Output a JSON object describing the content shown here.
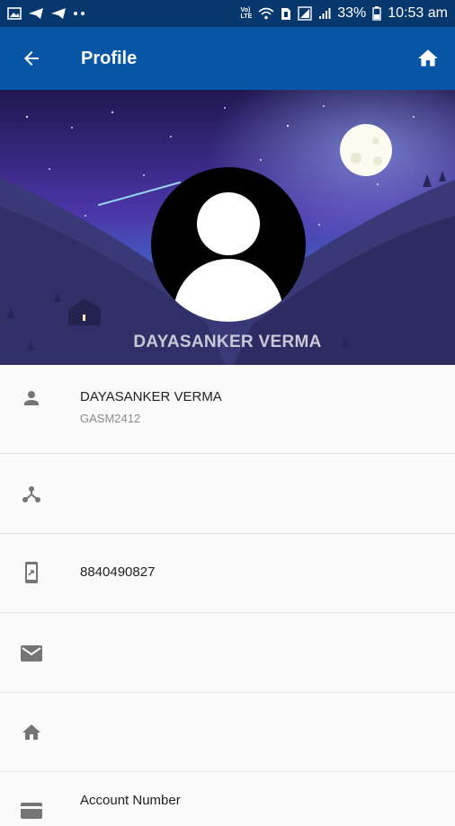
{
  "status_bar": {
    "network_label": "Vo)\nLTE",
    "battery_percent": "33%",
    "time": "10:53 am"
  },
  "app_bar": {
    "title": "Profile",
    "back_icon": "arrow-left-icon",
    "home_icon": "home-icon"
  },
  "hero": {
    "name": "DAYASANKER VERMA"
  },
  "profile_rows": [
    {
      "icon": "person-icon",
      "primary": "DAYASANKER VERMA",
      "secondary": "GASM2412"
    },
    {
      "icon": "share-nodes-icon",
      "primary": ""
    },
    {
      "icon": "phone-icon",
      "primary": "8840490827"
    },
    {
      "icon": "mail-icon",
      "primary": ""
    },
    {
      "icon": "home-icon",
      "primary": ""
    },
    {
      "icon": "card-icon",
      "primary": "Account Number"
    }
  ],
  "colors": {
    "status_bar": "#06386e",
    "app_bar": "#0756a5",
    "list_background": "#fafafa",
    "icon_gray": "#757575"
  }
}
